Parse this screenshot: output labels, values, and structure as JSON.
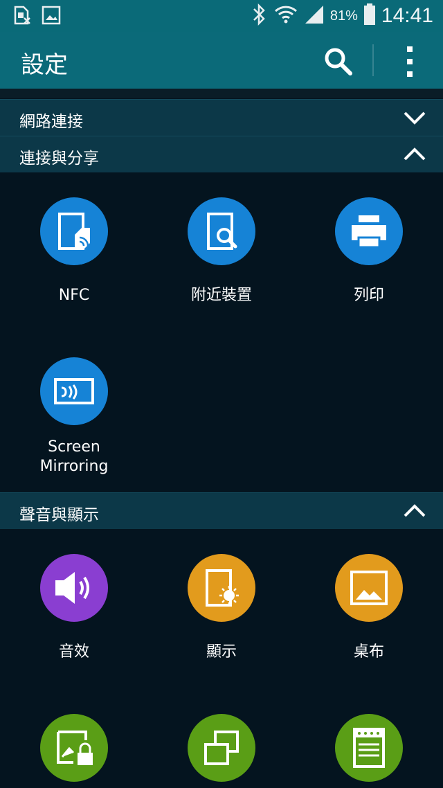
{
  "status_bar": {
    "battery_percent": "81%",
    "time": "14:41"
  },
  "app_bar": {
    "title": "設定"
  },
  "sections": [
    {
      "label": "網路連接",
      "expanded": false
    },
    {
      "label": "連接與分享",
      "expanded": true
    },
    {
      "label": "聲音與顯示",
      "expanded": true
    }
  ],
  "connect_items": [
    {
      "label": "NFC",
      "icon": "nfc-icon"
    },
    {
      "label": "附近裝置",
      "icon": "nearby-devices-icon"
    },
    {
      "label": "列印",
      "icon": "printer-icon"
    },
    {
      "label": "Screen Mirroring",
      "icon": "screen-mirroring-icon"
    }
  ],
  "display_items": [
    {
      "label": "音效",
      "icon": "sound-icon"
    },
    {
      "label": "顯示",
      "icon": "display-icon"
    },
    {
      "label": "桌布",
      "icon": "wallpaper-icon"
    },
    {
      "label": "",
      "icon": "lock-screen-icon"
    },
    {
      "label": "",
      "icon": "multi-window-icon"
    },
    {
      "label": "",
      "icon": "notification-panel-icon"
    }
  ],
  "colors": {
    "status_bar": "#0a6a78",
    "app_bar": "#0b6a79",
    "section_header": "#0c3848",
    "background": "#04141f",
    "blue": "#1683d6",
    "purple": "#8a3ed1",
    "orange": "#e29b1d",
    "green": "#5a9e16"
  }
}
